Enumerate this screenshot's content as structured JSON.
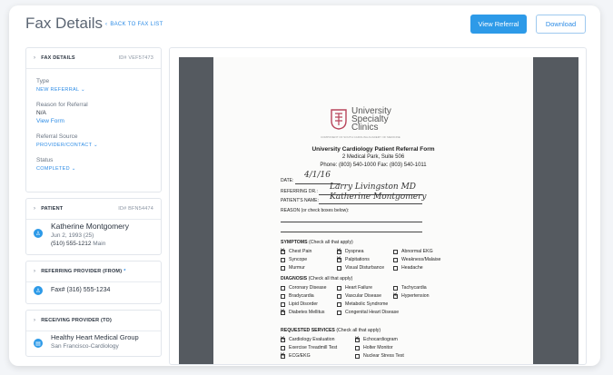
{
  "header": {
    "title": "Fax Details",
    "back_label": "BACK TO FAX LIST",
    "view_referral_label": "View Referral",
    "download_label": "Download"
  },
  "fax_details": {
    "heading": "FAX DETAILS",
    "id": "ID# VEF57473",
    "type_label": "Type",
    "type_value": "NEW REFERRAL",
    "reason_label": "Reason for Referral",
    "reason_value": "N/A",
    "view_form_label": "View Form",
    "source_label": "Referral Source",
    "source_value": "PROVIDER/CONTACT",
    "status_label": "Status",
    "status_value": "COMPLETED"
  },
  "patient": {
    "heading": "PATIENT",
    "id": "ID# BFN54474",
    "name": "Katherine Montgomery",
    "dob": "Jun 2, 1993 (25)",
    "phone": "(510) 555-1212",
    "phone_type": "Main"
  },
  "referring_provider": {
    "heading": "REFERRING PROVIDER (FROM)",
    "required_mark": "*",
    "fax": "Fax# (316) 555-1234"
  },
  "receiving_provider": {
    "heading": "RECEIVING PROVIDER (TO)",
    "name": "Healthy Heart Medical Group",
    "sub": "San Francisco-Cardiology"
  },
  "document": {
    "logo_line1": "University",
    "logo_line2": "Specialty",
    "logo_line3": "Clinics",
    "logo_tagline": "COMPONENT OF SOUTH CAROLINA ACADEMY OF MEDICINE",
    "form_title": "University Cardiology Patient Referral Form",
    "address": "2 Medical Park, Suite 506",
    "phone_fax": "Phone: (803) 540-1000  Fax: (803) 540-1011",
    "date_label": "DATE:",
    "date_value": "4/1/16",
    "referring_dr_label": "REFERRING DR.:",
    "referring_dr_value": "Larry Livingston MD",
    "patient_name_label": "PATIENT'S NAME:",
    "patient_name_value": "Katherine Montgomery",
    "reason_label": "REASON (or check boxes below):",
    "symptoms_heading": "SYMPTOMS",
    "symptoms_note": "(Check all that apply)",
    "symptoms": [
      {
        "label": "Chest Pain",
        "checked": true
      },
      {
        "label": "Dyspnea",
        "checked": true
      },
      {
        "label": "Abnormal EKG",
        "checked": false
      },
      {
        "label": "Syncope",
        "checked": false
      },
      {
        "label": "Palpitations",
        "checked": true
      },
      {
        "label": "Weakness/Malaise",
        "checked": false
      },
      {
        "label": "Murmur",
        "checked": false
      },
      {
        "label": "Visual Disturbance",
        "checked": false
      },
      {
        "label": "Headache",
        "checked": false
      }
    ],
    "diagnosis_heading": "DIAGNOSIS",
    "diagnosis_note": "(Check all that apply)",
    "diagnosis": [
      {
        "label": "Coronary Disease",
        "checked": false
      },
      {
        "label": "Heart Failure",
        "checked": false
      },
      {
        "label": "Tachycardia",
        "checked": false
      },
      {
        "label": "Bradycardia",
        "checked": false
      },
      {
        "label": "Vascular Disease",
        "checked": false
      },
      {
        "label": "Hypertension",
        "checked": true
      },
      {
        "label": "Lipid Disorder",
        "checked": false
      },
      {
        "label": "Metabolic Syndrome",
        "checked": false
      },
      {
        "label": "",
        "checked": false
      },
      {
        "label": "Diabetes Mellitus",
        "checked": true
      },
      {
        "label": "Congenital Heart Disease",
        "checked": false
      }
    ],
    "services_heading": "REQUESTED SERVICES",
    "services_note": "(Check all that apply)",
    "services": [
      {
        "label": "Cardiology Evaluation",
        "checked": true
      },
      {
        "label": "Echocardiogram",
        "checked": true
      },
      {
        "label": "Exercise Treadmill Test",
        "checked": false
      },
      {
        "label": "Holter Monitor",
        "checked": false
      },
      {
        "label": "ECG/EKG",
        "checked": true
      },
      {
        "label": "Nuclear Stress Test",
        "checked": false
      }
    ]
  }
}
